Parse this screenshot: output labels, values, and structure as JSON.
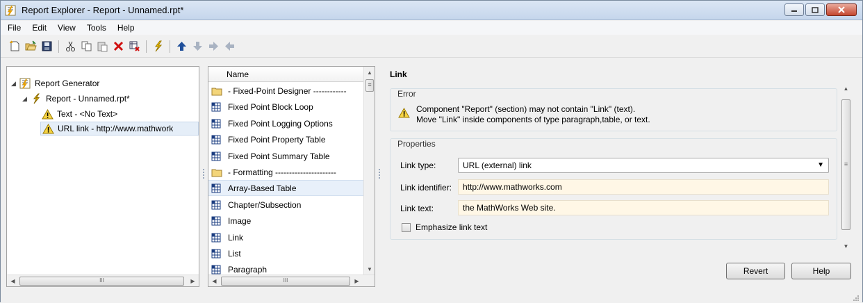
{
  "window": {
    "title": "Report Explorer - Report - Unnamed.rpt*",
    "controls": [
      "minimize",
      "maximize",
      "close"
    ]
  },
  "menu": [
    "File",
    "Edit",
    "View",
    "Tools",
    "Help"
  ],
  "toolbar": {
    "icons": [
      "new-file-icon",
      "open-folder-icon",
      "save-icon",
      "cut-icon",
      "copy-icon",
      "paste-icon",
      "delete-icon",
      "delete-component-icon",
      "run-report-icon",
      "move-up-icon",
      "move-down-icon",
      "move-right-icon",
      "move-left-icon"
    ]
  },
  "tree": {
    "items": [
      {
        "label": "Report Generator",
        "level": 0
      },
      {
        "label": "Report - Unnamed.rpt*",
        "level": 1
      },
      {
        "label": "Text - <No Text>",
        "level": 2
      },
      {
        "label": "URL link - http://www.mathwork",
        "level": 2,
        "selected": true
      }
    ],
    "scrollbar_thumb": "III"
  },
  "list": {
    "header": "Name",
    "items": [
      {
        "label": "- Fixed-Point Designer ------------",
        "type": "folder"
      },
      {
        "label": "Fixed Point Block Loop",
        "type": "component"
      },
      {
        "label": "Fixed Point Logging Options",
        "type": "component"
      },
      {
        "label": "Fixed Point Property Table",
        "type": "component"
      },
      {
        "label": "Fixed Point Summary Table",
        "type": "component"
      },
      {
        "label": "- Formatting ----------------------",
        "type": "folder"
      },
      {
        "label": "Array-Based Table",
        "type": "component",
        "selected": true
      },
      {
        "label": "Chapter/Subsection",
        "type": "component"
      },
      {
        "label": "Image",
        "type": "component"
      },
      {
        "label": "Link",
        "type": "component"
      },
      {
        "label": "List",
        "type": "component"
      },
      {
        "label": "Paragraph",
        "type": "component"
      }
    ],
    "scrollbar_thumb": "III"
  },
  "properties": {
    "title": "Link",
    "error": {
      "legend": "Error",
      "line1": "Component \"Report\" (section) may not contain \"Link\" (text).",
      "line2": "Move \"Link\" inside components of type paragraph,table, or text."
    },
    "group": {
      "legend": "Properties",
      "link_type_label": "Link type:",
      "link_type_value": "URL (external) link",
      "link_identifier_label": "Link identifier:",
      "link_identifier_value": "http://www.mathworks.com",
      "link_text_label": "Link text:",
      "link_text_value": "the MathWorks Web site.",
      "emphasize_label": "Emphasize link text",
      "emphasize_checked": false
    },
    "revert_label": "Revert",
    "help_label": "Help"
  }
}
